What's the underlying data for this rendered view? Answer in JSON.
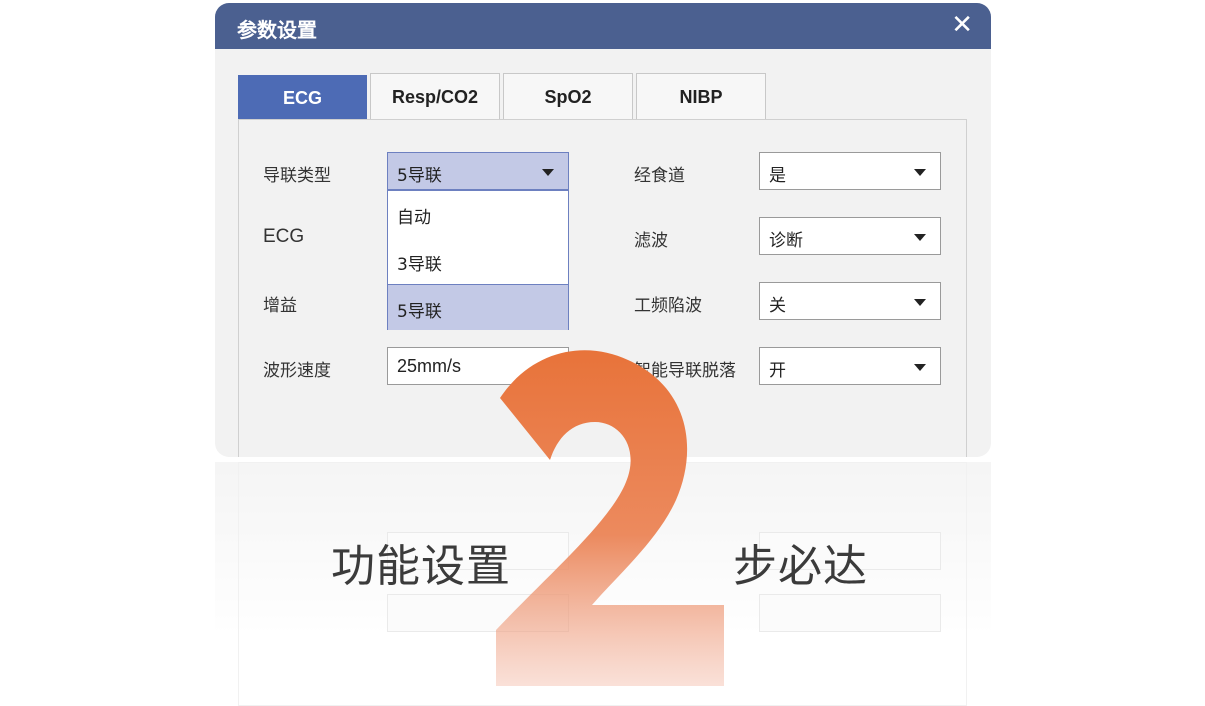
{
  "dialog": {
    "title": "参数设置",
    "close_glyph": "✕",
    "tabs": [
      {
        "label": "ECG",
        "active": true
      },
      {
        "label": "Resp/CO2",
        "active": false
      },
      {
        "label": "SpO2",
        "active": false
      },
      {
        "label": "NIBP",
        "active": false
      }
    ],
    "fields": {
      "lead_type": {
        "label": "导联类型",
        "value": "5导联"
      },
      "ecg": {
        "label": "ECG"
      },
      "gain": {
        "label": "增益"
      },
      "sweep_speed": {
        "label": "波形速度",
        "value": "25mm/s"
      },
      "esophageal": {
        "label": "经食道",
        "value": "是"
      },
      "filter": {
        "label": "滤波",
        "value": "诊断"
      },
      "notch": {
        "label": "工频陷波",
        "value": "关"
      },
      "smart_lead_off": {
        "label": "智能导联脱落",
        "value": "开"
      }
    },
    "lead_type_options": [
      "自动",
      "3导联",
      "5导联"
    ],
    "lead_type_selected": "5导联"
  },
  "overlay": {
    "numeral": "2",
    "left_text": "功能设置",
    "right_text": "步必达",
    "gradient_colors": [
      "#e8733a",
      "#f0a890"
    ]
  }
}
